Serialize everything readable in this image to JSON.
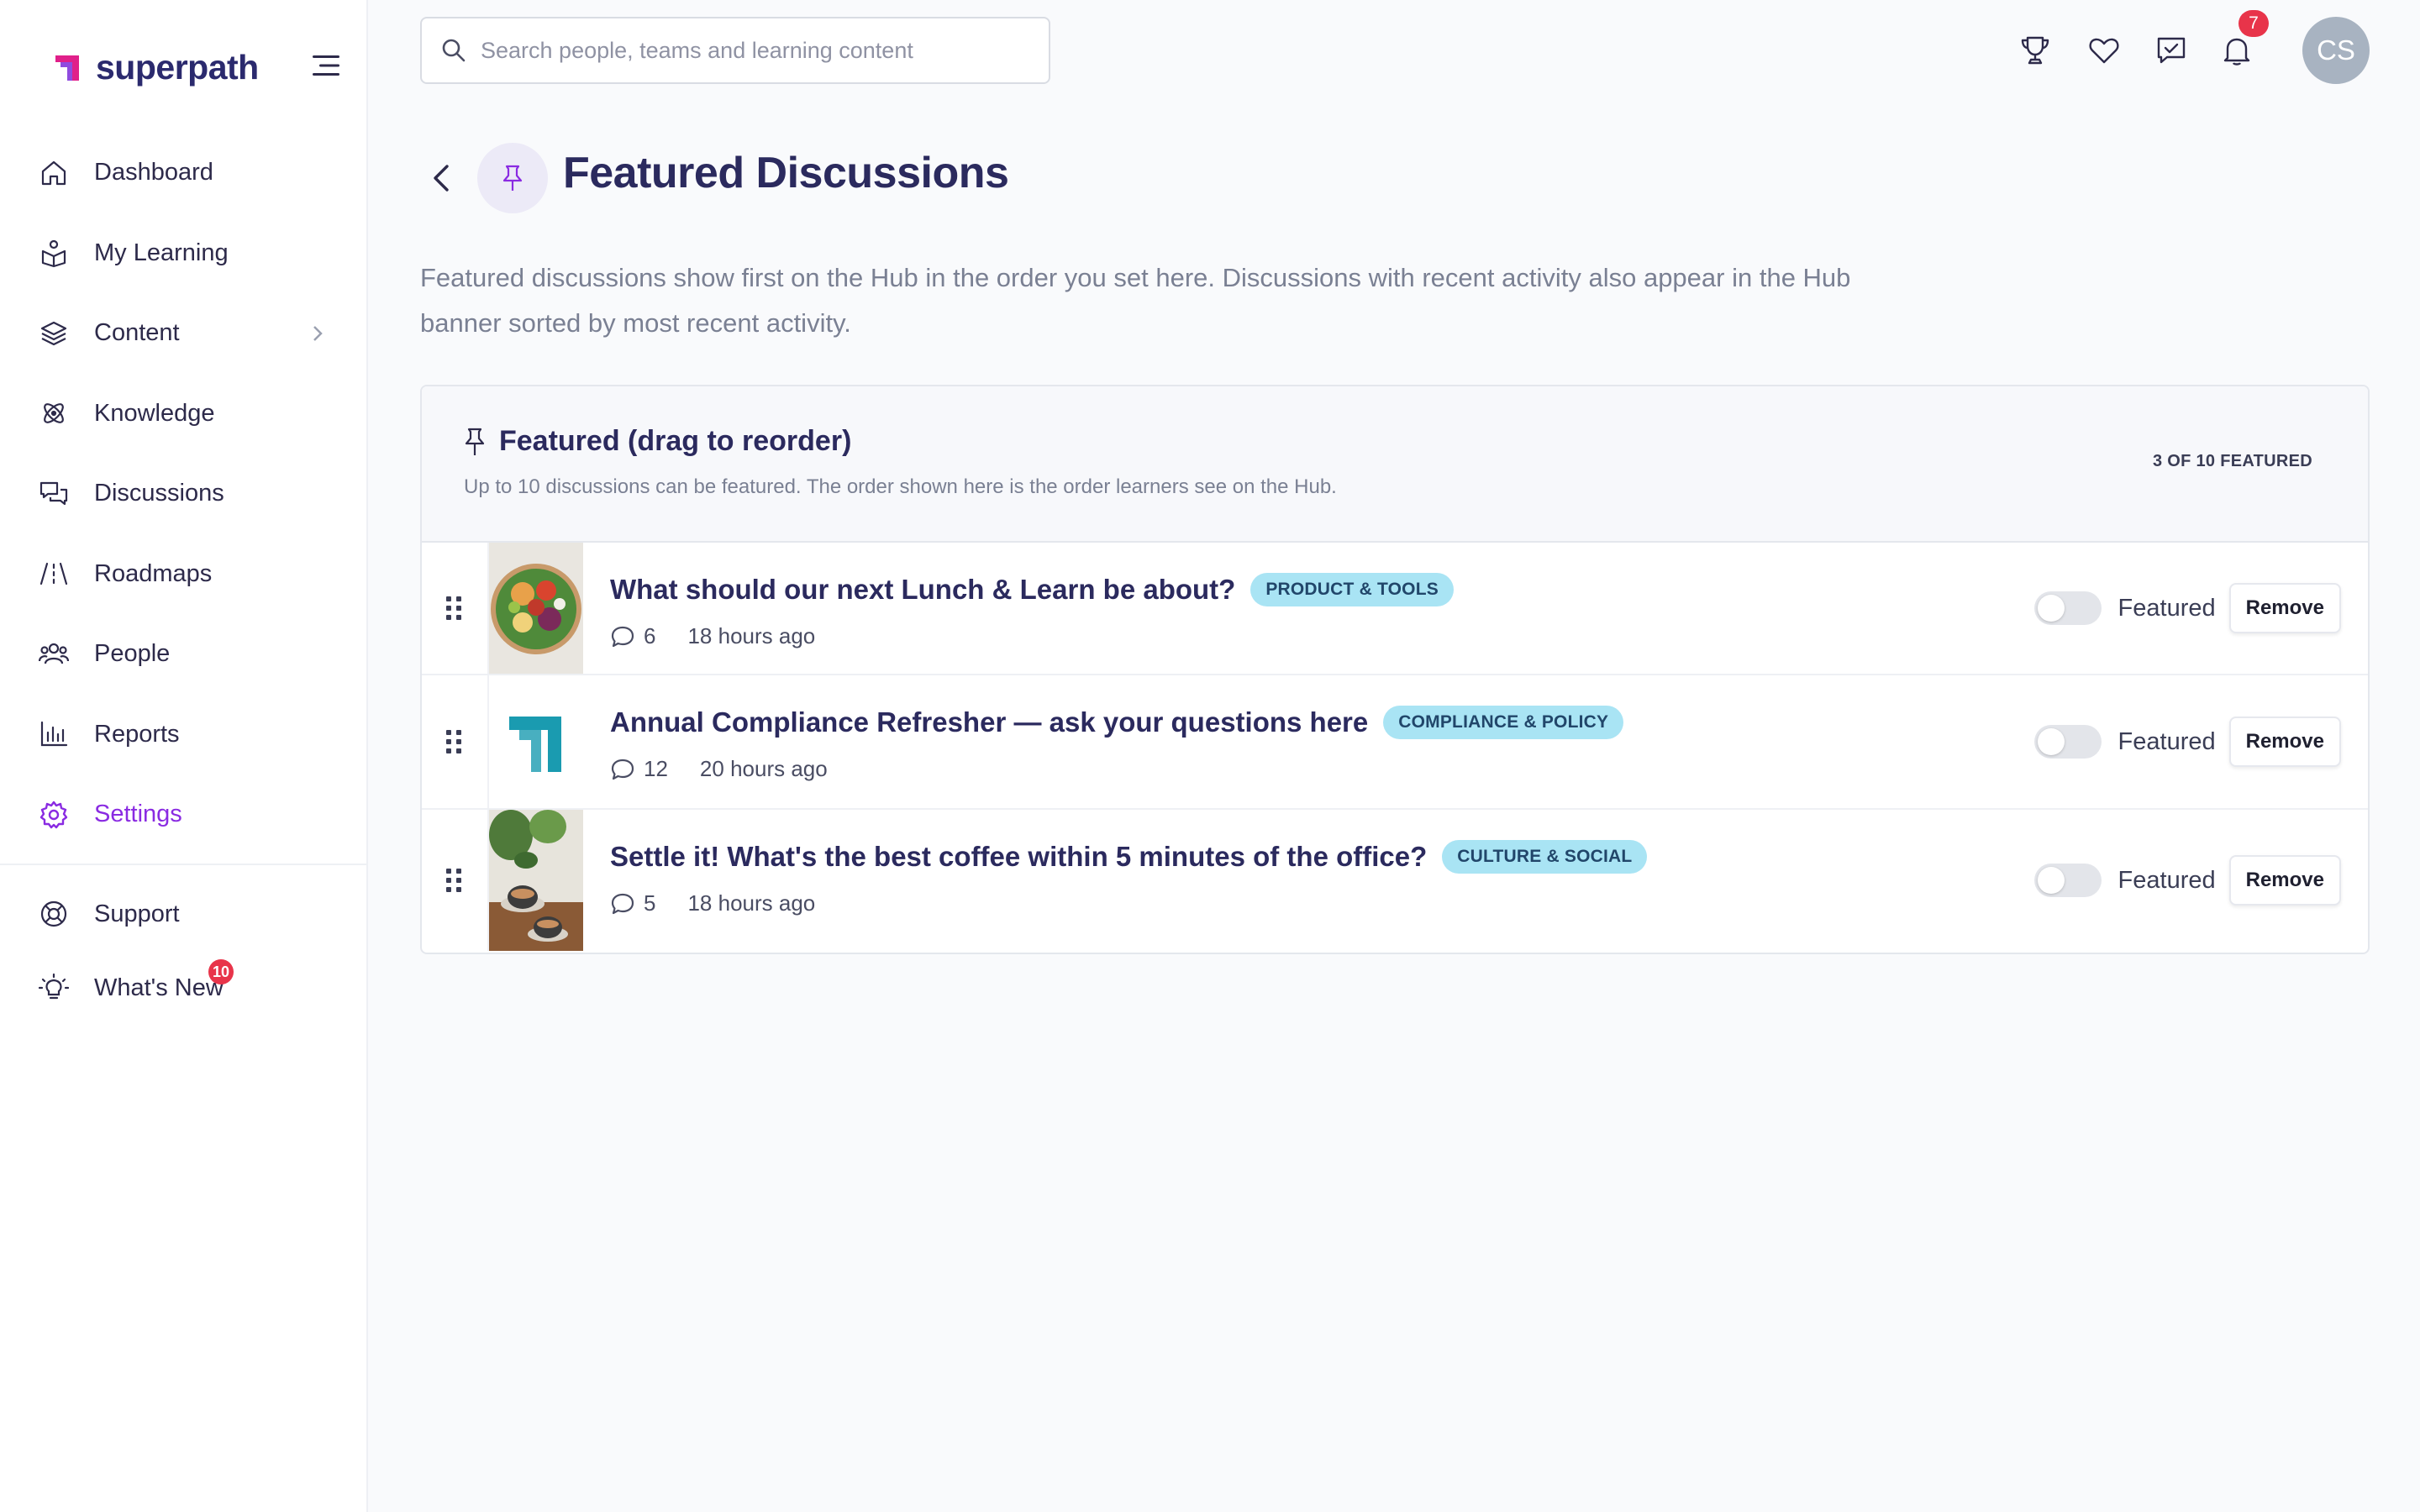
{
  "app": {
    "brand": "superpath",
    "colors": {
      "accent": "#8a2be2",
      "brand_magenta": "#e0208a",
      "brand_navy": "#2b2a6e",
      "tag_bg": "#a9e4f4",
      "badge_red": "#e8344a"
    }
  },
  "sidebar": {
    "items": [
      {
        "label": "Dashboard",
        "icon": "home-icon"
      },
      {
        "label": "My Learning",
        "icon": "learning-icon"
      },
      {
        "label": "Content",
        "icon": "layers-icon",
        "has_chevron": true
      },
      {
        "label": "Knowledge",
        "icon": "atom-icon"
      },
      {
        "label": "Discussions",
        "icon": "chat-bubbles-icon"
      },
      {
        "label": "Roadmaps",
        "icon": "road-icon"
      },
      {
        "label": "People",
        "icon": "people-icon"
      },
      {
        "label": "Reports",
        "icon": "bar-chart-icon"
      },
      {
        "label": "Settings",
        "icon": "gear-icon",
        "active": true
      }
    ],
    "secondary": [
      {
        "label": "Support",
        "icon": "lifebuoy-icon"
      },
      {
        "label": "What's New",
        "icon": "lightbulb-icon",
        "badge": "10"
      }
    ]
  },
  "topbar": {
    "search_placeholder": "Search people, teams and learning content",
    "search_value": "",
    "icons": [
      "trophy-icon",
      "heart-icon",
      "message-check-icon",
      "bell-icon"
    ],
    "notifications_count": "7",
    "avatar_initials": "CS"
  },
  "page": {
    "title": "Featured Discussions",
    "description": "Featured discussions show first on the Hub in the order you set here. Discussions with recent activity also appear in the Hub banner sorted by most recent activity."
  },
  "featured": {
    "title": "Featured (drag to reorder)",
    "subtitle": "Up to 10 discussions can be featured. The order shown here is the order learners see on the Hub.",
    "count_label": "3 OF 10 FEATURED",
    "toggle_label": "Featured",
    "remove_label": "Remove",
    "rows": [
      {
        "title": "What should our next Lunch & Learn be about?",
        "tag": "PRODUCT & TOOLS",
        "comments": "6",
        "time": "18 hours ago",
        "thumb": "salad-bowl-image",
        "featured": false
      },
      {
        "title": "Annual Compliance Refresher — ask your questions here",
        "tag": "COMPLIANCE & POLICY",
        "comments": "12",
        "time": "20 hours ago",
        "thumb": "superpath-logo-image",
        "featured": false
      },
      {
        "title": "Settle it! What's the best coffee within 5 minutes of the office?",
        "tag": "CULTURE & SOCIAL",
        "comments": "5",
        "time": "18 hours ago",
        "thumb": "coffee-cups-image",
        "featured": false
      }
    ]
  }
}
